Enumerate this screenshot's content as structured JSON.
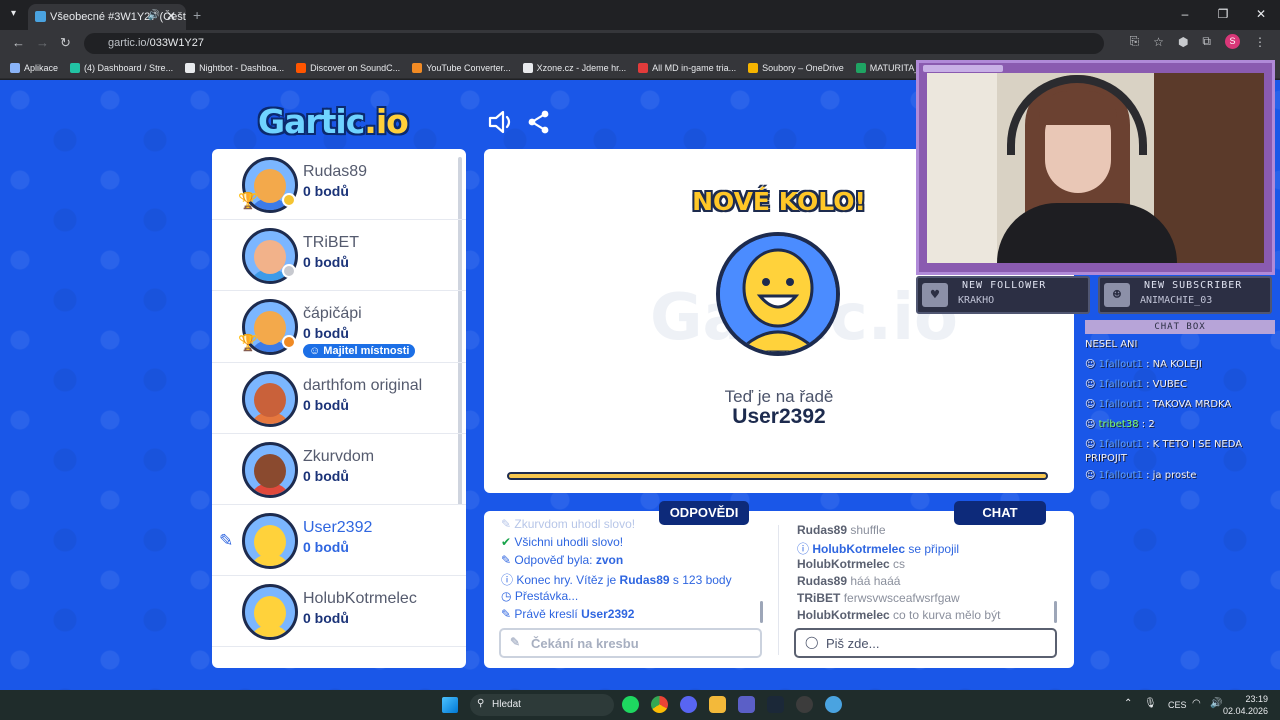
{
  "browser": {
    "tab_title": "Všeobecné #3W1Y27 (Češt",
    "url_scheme_host": "gartic.io/",
    "url_path": "033W1Y27",
    "profile_initial": "S",
    "bookmarks": [
      {
        "label": "Aplikace",
        "color": "#8ab4f8"
      },
      {
        "label": "(4) Dashboard / Stre...",
        "color": "#22c3a4"
      },
      {
        "label": "Nightbot - Dashboa...",
        "color": "#e8eaed"
      },
      {
        "label": "Discover on SoundC...",
        "color": "#ff5500"
      },
      {
        "label": "YouTube Converter...",
        "color": "#f28b24"
      },
      {
        "label": "Xzone.cz - Jdeme hr...",
        "color": "#e8eaed"
      },
      {
        "label": "All MD in-game tria...",
        "color": "#e23b3b"
      },
      {
        "label": "Soubory – OneDrive",
        "color": "#f5b400"
      },
      {
        "label": "MATURITA_OKRUH...",
        "color": "#1fa463"
      }
    ]
  },
  "game": {
    "logo_text": "Gartic",
    "logo_suffix": ".io",
    "owner_badge": "Majitel místnosti",
    "players": [
      {
        "name": "Rudas89",
        "points": "0 bodů",
        "skin": "#f3a94b",
        "body": "#3c7be8",
        "dot": "#f5c431",
        "trophy": true
      },
      {
        "name": "TRiBET",
        "points": "0 bodů",
        "skin": "#f2b28a",
        "body": "#3d9be9",
        "dot": "#c7c9cf",
        "trophy": false
      },
      {
        "name": "čápičápi",
        "points": "0 bodů",
        "skin": "#f3a94b",
        "body": "#3c7be8",
        "dot": "#f08a24",
        "trophy": true,
        "owner": true
      },
      {
        "name": "darthfom original",
        "points": "0 bodů",
        "skin": "#c9613a",
        "body": "#e5773e",
        "dot": "",
        "trophy": false
      },
      {
        "name": "Zkurvdom",
        "points": "0 bodů",
        "skin": "#8a4a2f",
        "body": "#e0493c",
        "dot": "",
        "trophy": false
      },
      {
        "name": "User2392",
        "points": "0 bodů",
        "skin": "#ffd23b",
        "body": "#ffd23b",
        "dot": "",
        "trophy": false,
        "me": true
      },
      {
        "name": "HolubKotrmelec",
        "points": "0 bodů",
        "skin": "#ffd23b",
        "body": "#ffd23b",
        "dot": "",
        "trophy": false
      }
    ],
    "round_title": "NOVÉ KOLO!",
    "turn_label": "Teď je na řadě",
    "turn_user": "User2392",
    "timer_progress_pct": 100,
    "tabs": {
      "answers": "ODPOVĚDI",
      "chat": "CHAT"
    },
    "log": [
      {
        "icon": "✔",
        "text": "Všichni uhodli slovo!",
        "cls": "g"
      },
      {
        "icon": "✎",
        "text": "Odpověď byla: ",
        "bold": "zvon"
      },
      {
        "icon": "ⓘ",
        "text": "Konec hry. Vítěz je ",
        "bold": "Rudas89",
        "tail": " s 123 body"
      },
      {
        "icon": "◷",
        "text": "Přestávka..."
      },
      {
        "icon": "✎",
        "text": "Právě kreslí ",
        "bold": "User2392"
      }
    ],
    "chat": [
      {
        "user": "Rudas89",
        "msg": "shuffle",
        "join": false
      },
      {
        "user": "HolubKotrmelec",
        "msg": "se připojil",
        "join": true
      },
      {
        "user": "HolubKotrmelec",
        "msg": "cs",
        "join": false
      },
      {
        "user": "Rudas89",
        "msg": "háá haáá",
        "join": false
      },
      {
        "user": "TRiBET",
        "msg": "ferwsvwsceafwsrfgaw",
        "join": false
      },
      {
        "user": "HolubKotrmelec",
        "msg": "co to kurva mělo být",
        "join": false
      }
    ],
    "answer_placeholder": "Čekání na kresbu",
    "chat_placeholder": "Piš zde..."
  },
  "overlay": {
    "new_follower_title": "NEW FOLLOWER",
    "new_follower_value": "KRAKHO",
    "new_sub_title": "NEW SUBSCRIBER",
    "new_sub_value": "ANIMACHIE_03",
    "chatbox_title": "CHAT BOX",
    "chatbox_lines": [
      {
        "user": "",
        "msg": "NESEL ANI"
      },
      {
        "user": "1fallout1",
        "msg": ": NA KOLEJI"
      },
      {
        "user": "1fallout1",
        "msg": ": VUBEC"
      },
      {
        "user": "1fallout1",
        "msg": ": TAKOVA MRDKA"
      },
      {
        "user": "tribet38",
        "msg": ": 2",
        "green": true
      },
      {
        "user": "1fallout1",
        "msg": ": K TETO  I SE NEDA PRIPOJIT"
      },
      {
        "user": "1fallout1",
        "msg": ": ja proste"
      }
    ]
  },
  "taskbar": {
    "search_placeholder": "Hledat",
    "lang": "CES",
    "time": "23:19",
    "date": "02.04.2026"
  }
}
